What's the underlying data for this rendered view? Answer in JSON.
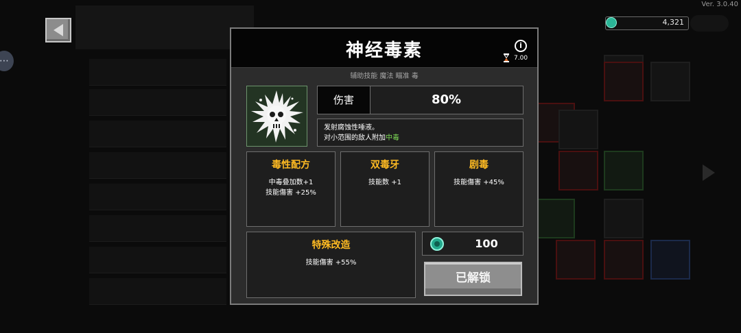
{
  "version": "Ver. 3.0.40",
  "currency": {
    "amount": "4,321",
    "icon": "gem-icon",
    "color": "#2bb597"
  },
  "modal": {
    "title": "神经毒素",
    "cooldown": "7.00",
    "tags": "辅助技能  魔法  瞄准  毒",
    "damage": {
      "label": "伤害",
      "value": "80%"
    },
    "description": {
      "line1": "发射腐蚀性唾液。",
      "line2_prefix": "对小范围的敌人附加",
      "line2_highlight": "中毒"
    },
    "upgrades": [
      {
        "title": "毒性配方",
        "lines": [
          "中毒叠加数+1",
          "技能傷害 +25%"
        ]
      },
      {
        "title": "双毒牙",
        "lines": [
          "技能数 +1"
        ]
      },
      {
        "title": "剧毒",
        "lines": [
          "技能傷害 +45%"
        ]
      },
      {
        "title": "特殊改造",
        "lines": [
          "技能傷害 +55%"
        ]
      }
    ],
    "cost": "100",
    "unlock_label": "已解锁",
    "colors": {
      "upgrade_title": "#ffbb22",
      "highlight": "#7ed957"
    }
  }
}
